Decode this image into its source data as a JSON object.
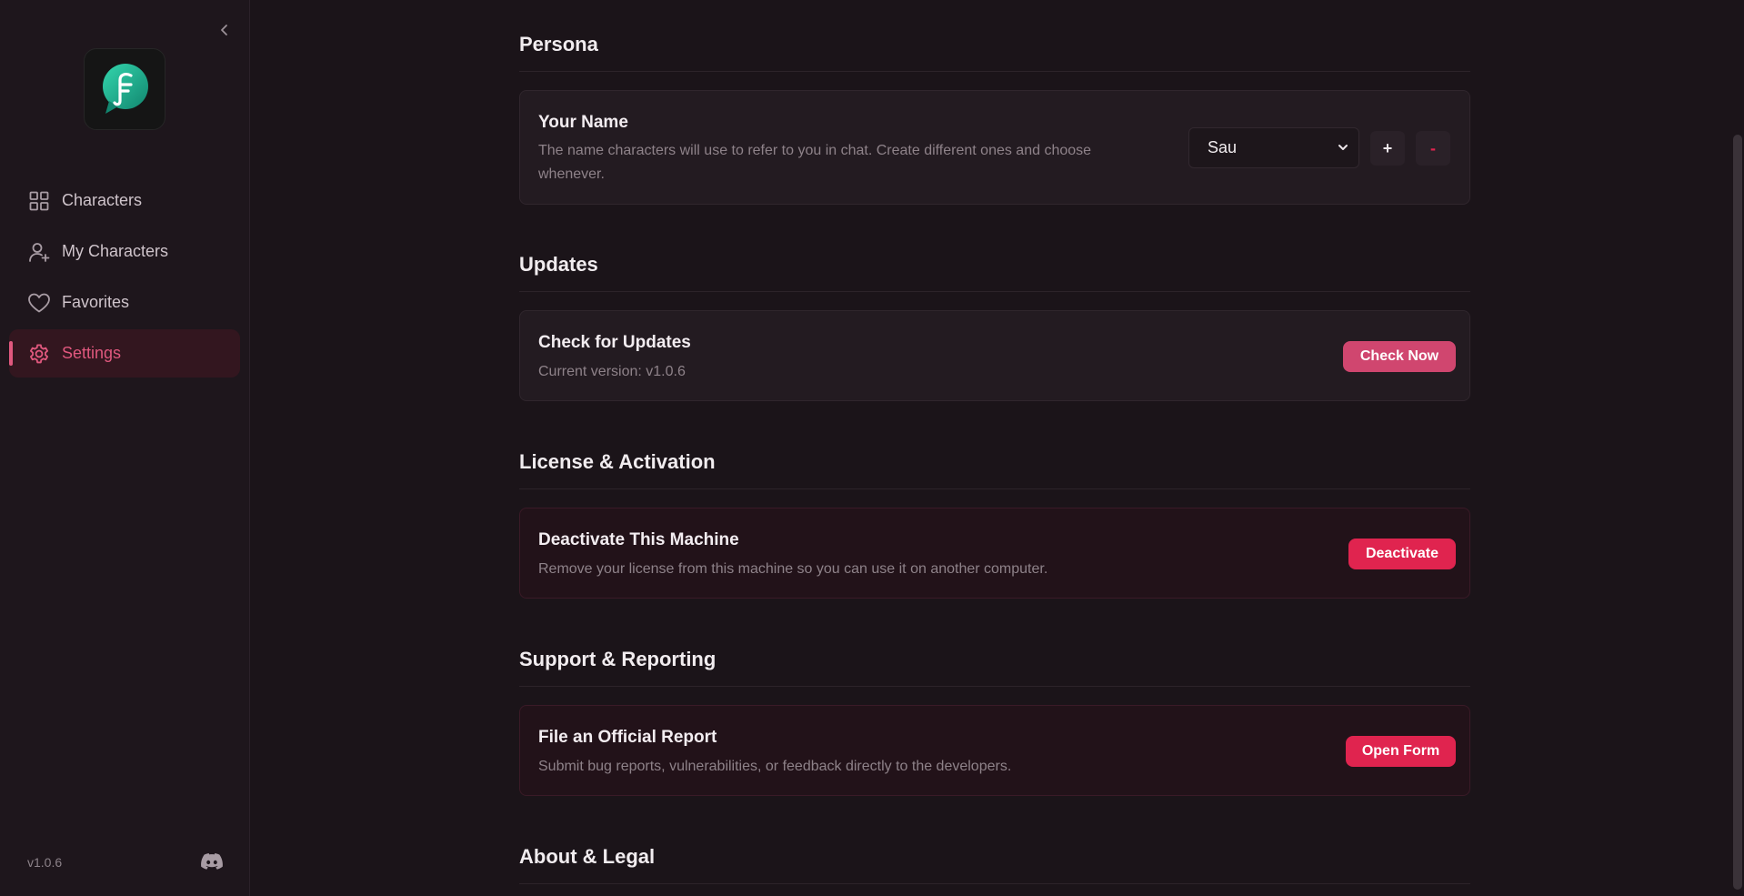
{
  "sidebar": {
    "logo_letter": "F",
    "nav": [
      {
        "label": "Characters",
        "icon": "grid-icon",
        "active": false
      },
      {
        "label": "My Characters",
        "icon": "user-plus-icon",
        "active": false
      },
      {
        "label": "Favorites",
        "icon": "heart-icon",
        "active": false
      },
      {
        "label": "Settings",
        "icon": "gear-icon",
        "active": true
      }
    ],
    "version": "v1.0.6"
  },
  "sections": {
    "persona": {
      "title": "Persona",
      "card_title": "Your Name",
      "card_desc": "The name characters will use to refer to you in chat. Create different ones and choose whenever.",
      "selected_name": "Sau",
      "add_label": "+",
      "remove_label": "-"
    },
    "updates": {
      "title": "Updates",
      "card_title": "Check for Updates",
      "card_desc": "Current version: v1.0.6",
      "button_label": "Check Now"
    },
    "license": {
      "title": "License & Activation",
      "card_title": "Deactivate This Machine",
      "card_desc": "Remove your license from this machine so you can use it on another computer.",
      "button_label": "Deactivate"
    },
    "support": {
      "title": "Support & Reporting",
      "card_title": "File an Official Report",
      "card_desc": "Submit bug reports, vulnerabilities, or feedback directly to the developers.",
      "button_label": "Open Form"
    },
    "about": {
      "title": "About & Legal"
    }
  },
  "colors": {
    "accent": "#e0587e",
    "primary_button": "#d0466f",
    "danger_button": "#e0244f",
    "background": "#1b1419",
    "logo_gradient_start": "#2fd2a8",
    "logo_gradient_end": "#13826f"
  }
}
